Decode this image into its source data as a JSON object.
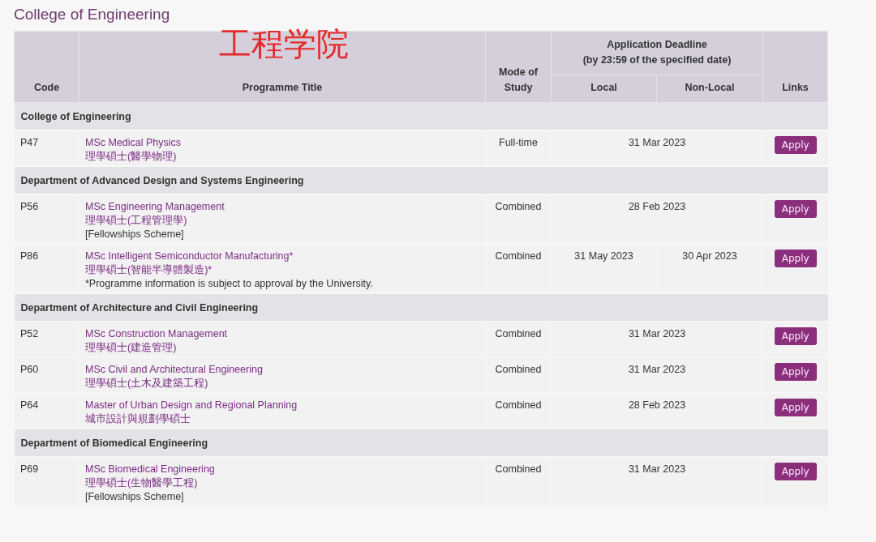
{
  "page_title": "College of Engineering",
  "annotation": "工程学院",
  "table": {
    "columns": {
      "code": "Code",
      "title": "Programme Title",
      "mode": "Mode of Study",
      "deadline": "Application Deadline\n(by 23:59 of the specified date)",
      "local": "Local",
      "non_local": "Non-Local",
      "links": "Links"
    },
    "sections": [
      {
        "heading": "College of Engineering",
        "programmes": [
          {
            "code": "P47",
            "title": "MSc Medical Physics",
            "title_zh": "理學碩士(醫學物理)",
            "mode": "Full-time",
            "deadlines": [
              "31 Mar 2023"
            ],
            "action": "Apply"
          }
        ]
      },
      {
        "heading": "Department of Advanced Design and Systems Engineering",
        "programmes": [
          {
            "code": "P56",
            "title": "MSc Engineering Management",
            "title_zh": "理學碩士(工程管理學)",
            "note": "[Fellowships Scheme]",
            "mode": "Combined",
            "deadlines": [
              "28 Feb 2023"
            ],
            "action": "Apply"
          },
          {
            "code": "P86",
            "title": "MSc Intelligent Semiconductor Manufacturing*",
            "title_zh": "理學碩士(智能半導體製造)*",
            "note": "*Programme information is subject to approval by the University.",
            "mode": "Combined",
            "deadlines": [
              "31 May 2023",
              "30 Apr 2023"
            ],
            "action": "Apply"
          }
        ]
      },
      {
        "heading": "Department of Architecture and Civil Engineering",
        "programmes": [
          {
            "code": "P52",
            "title": "MSc Construction Management",
            "title_zh": "理學碩士(建造管理)",
            "mode": "Combined",
            "deadlines": [
              "31 Mar 2023"
            ],
            "action": "Apply"
          },
          {
            "code": "P60",
            "title": "MSc Civil and Architectural Engineering",
            "title_zh": "理學碩士(土木及建築工程)",
            "mode": "Combined",
            "deadlines": [
              "31 Mar 2023"
            ],
            "action": "Apply"
          },
          {
            "code": "P64",
            "title": "Master of Urban Design and Regional Planning",
            "title_zh": "城市設計與規劃學碩士",
            "mode": "Combined",
            "deadlines": [
              "28 Feb 2023"
            ],
            "action": "Apply"
          }
        ]
      },
      {
        "heading": "Department of Biomedical Engineering",
        "programmes": [
          {
            "code": "P69",
            "title": "MSc Biomedical Engineering",
            "title_zh": "理學碩士(生物醫學工程)",
            "note": "[Fellowships Scheme]",
            "mode": "Combined",
            "deadlines": [
              "31 Mar 2023"
            ],
            "action": "Apply"
          }
        ]
      }
    ]
  }
}
